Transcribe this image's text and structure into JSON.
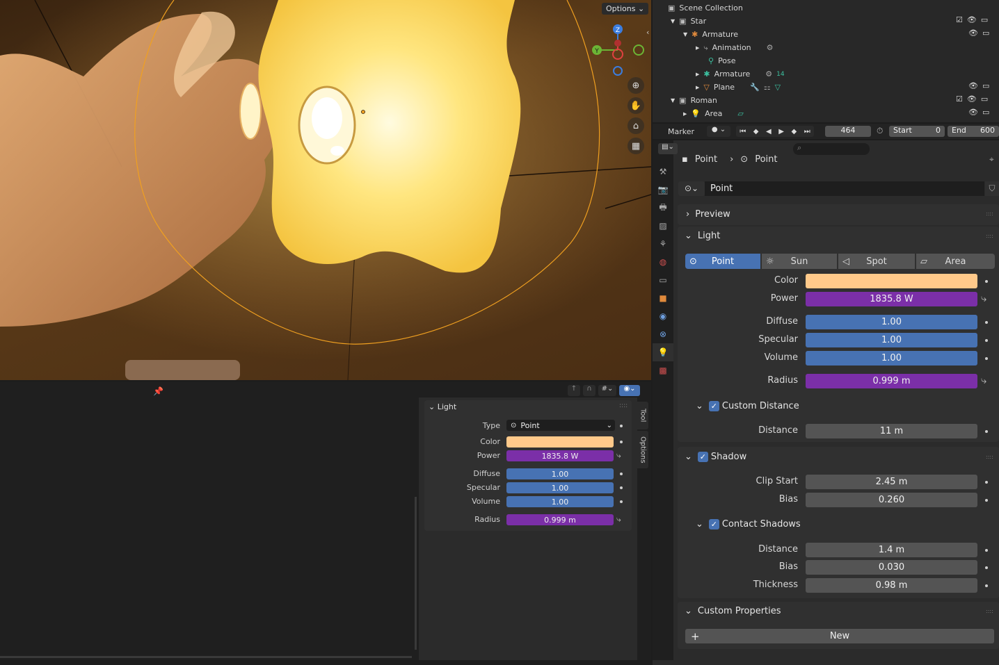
{
  "viewport": {
    "options_label": "Options ⌄",
    "gizmo": {
      "z": "Z",
      "y": "Y"
    }
  },
  "outliner": {
    "title": "Scene Collection",
    "rows": [
      {
        "label": "Star",
        "icon": "collection-icon"
      },
      {
        "label": "Armature",
        "icon": "armature-icon"
      },
      {
        "label": "Animation",
        "icon": "action-icon"
      },
      {
        "label": "Pose",
        "icon": "pose-icon"
      },
      {
        "label": "Armature",
        "icon": "armature-data-icon",
        "badge": "14"
      },
      {
        "label": "Plane",
        "icon": "mesh-icon"
      },
      {
        "label": "Roman",
        "icon": "collection-icon"
      },
      {
        "label": "Area",
        "icon": "light-icon"
      }
    ]
  },
  "timeline": {
    "marker": "Marker",
    "frame": "464",
    "start_label": "Start",
    "start": "0",
    "end_label": "End",
    "end": "600"
  },
  "properties": {
    "breadcrumb": [
      "Point",
      "Point"
    ],
    "datablock": "Point",
    "preview": "Preview",
    "light_section": "Light",
    "light_types": [
      "Point",
      "Sun",
      "Spot",
      "Area"
    ],
    "active_type": "Point",
    "color_label": "Color",
    "color": "#ffc98a",
    "power_label": "Power",
    "power": "1835.8 W",
    "diffuse_label": "Diffuse",
    "diffuse": "1.00",
    "specular_label": "Specular",
    "specular": "1.00",
    "volume_label": "Volume",
    "volume": "1.00",
    "radius_label": "Radius",
    "radius": "0.999 m",
    "custom_distance": "Custom Distance",
    "distance_label": "Distance",
    "distance": "11 m",
    "shadow": "Shadow",
    "clip_start_label": "Clip Start",
    "clip_start": "2.45 m",
    "bias_label": "Bias",
    "bias": "0.260",
    "contact_shadows": "Contact Shadows",
    "cs_distance_label": "Distance",
    "cs_distance": "1.4 m",
    "cs_bias_label": "Bias",
    "cs_bias": "0.030",
    "thickness_label": "Thickness",
    "thickness": "0.98 m",
    "custom_properties": "Custom Properties",
    "new_label": "New"
  },
  "npanel": {
    "section": "Light",
    "type_label": "Type",
    "type": "Point",
    "color_label": "Color",
    "power_label": "Power",
    "power": "1835.8 W",
    "diffuse_label": "Diffuse",
    "diffuse": "1.00",
    "specular_label": "Specular",
    "specular": "1.00",
    "volume_label": "Volume",
    "volume": "1.00",
    "radius_label": "Radius",
    "radius": "0.999 m",
    "tabs": [
      "Tool",
      "Options"
    ]
  },
  "colors": {
    "accent_blue": "#4772b3",
    "accent_purple": "#7b2fa8",
    "light_color": "#ffc98a"
  }
}
